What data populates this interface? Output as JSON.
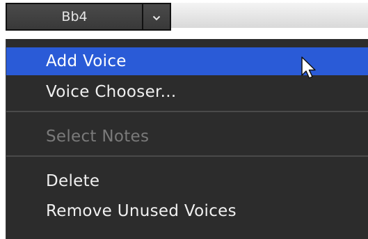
{
  "selector": {
    "value": "Bb4",
    "arrow_icon": "chevron-down-icon"
  },
  "menu": {
    "items": [
      {
        "label": "Add Voice",
        "state": "highlighted"
      },
      {
        "label": "Voice Chooser...",
        "state": "enabled"
      },
      {
        "label": "Select Notes",
        "state": "disabled"
      },
      {
        "label": "Delete",
        "state": "enabled"
      },
      {
        "label": "Remove Unused Voices",
        "state": "enabled"
      }
    ]
  },
  "colors": {
    "menu_background": "#2c2c2c",
    "highlight": "#2a5bd7",
    "text": "#f0f0f0",
    "disabled_text": "#7a7a7a"
  }
}
